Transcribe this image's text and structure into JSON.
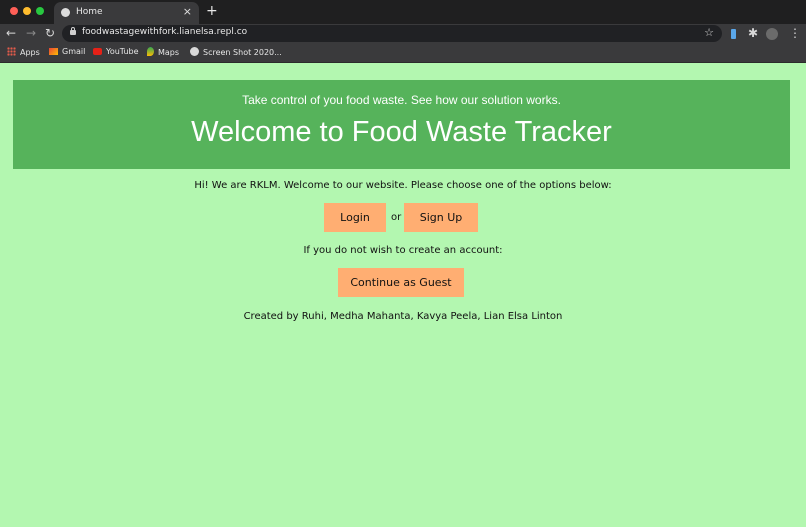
{
  "browser": {
    "tab_title": "Home",
    "tab_close": "×",
    "new_tab": "+",
    "url": "foodwastagewithfork.lianelsa.repl.co",
    "traffic_colors": [
      "#ff5f57",
      "#febc2e",
      "#28c840"
    ],
    "bookmarks": [
      {
        "label": "Apps",
        "icon": "apps-grid-icon"
      },
      {
        "label": "Gmail",
        "icon": "gmail-icon"
      },
      {
        "label": "YouTube",
        "icon": "youtube-icon"
      },
      {
        "label": "Maps",
        "icon": "maps-icon"
      },
      {
        "label": "Screen Shot 2020...",
        "icon": "globe-icon"
      }
    ]
  },
  "page": {
    "tagline": "Take control of you food waste. See how our solution works.",
    "title": "Welcome to Food Waste Tracker",
    "intro": "Hi! We are RKLM. Welcome to our website. Please choose one of the options below:",
    "login_label": "Login",
    "or_text": "or",
    "signup_label": "Sign Up",
    "guest_prompt": "If you do not wish to create an account:",
    "guest_label": "Continue as Guest",
    "credits": "Created by Ruhi, Medha Mahanta, Kavya Peela, Lian Elsa Linton"
  },
  "colors": {
    "background": "#b3f7b0",
    "header": "#56b35b",
    "button": "#ffae72"
  }
}
